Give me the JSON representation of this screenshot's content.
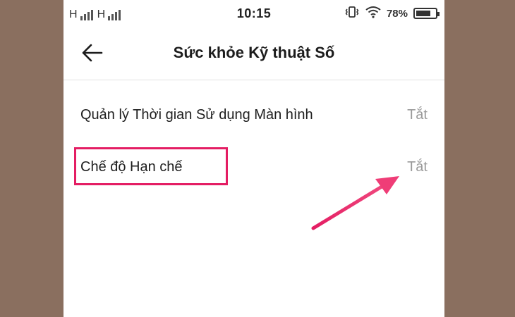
{
  "status_bar": {
    "network_1": "H",
    "network_2": "H",
    "time": "10:15",
    "battery_percent": "78%",
    "battery_level": 0.78
  },
  "header": {
    "title": "Sức khỏe Kỹ thuật Số"
  },
  "settings": {
    "items": [
      {
        "label": "Quản lý Thời gian Sử dụng Màn hình",
        "value": "Tắt"
      },
      {
        "label": "Chế độ Hạn chế",
        "value": "Tắt"
      }
    ]
  },
  "colors": {
    "annotation": "#e41d63",
    "background": "#8a6f5f",
    "value_text": "#9a9a9a"
  },
  "icons": {
    "back": "arrow-left-icon",
    "vibrate": "vibrate-icon",
    "wifi": "wifi-icon",
    "battery": "battery-icon"
  }
}
